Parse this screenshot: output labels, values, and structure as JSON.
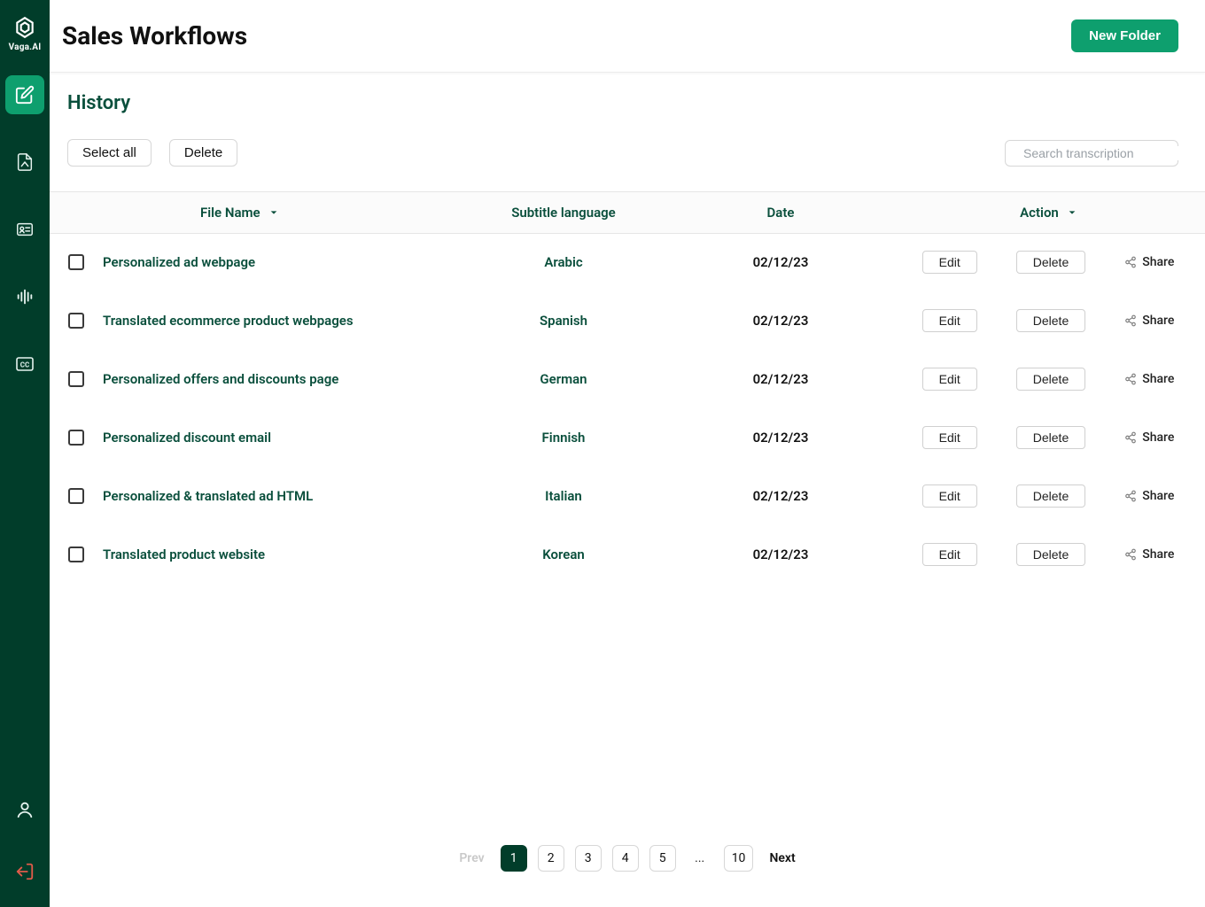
{
  "brand": {
    "name": "Vaga.AI"
  },
  "page": {
    "title": "Sales Workflows",
    "section_title": "History"
  },
  "actions": {
    "new_folder": "New Folder",
    "select_all": "Select all",
    "delete": "Delete",
    "search_placeholder": "Search transcription",
    "edit": "Edit",
    "row_delete": "Delete",
    "share": "Share"
  },
  "table": {
    "headers": {
      "file": "File Name",
      "lang": "Subtitle language",
      "date": "Date",
      "action": "Action"
    },
    "rows": [
      {
        "file": "Personalized ad webpage",
        "lang": "Arabic",
        "date": "02/12/23"
      },
      {
        "file": "Translated ecommerce product webpages",
        "lang": "Spanish",
        "date": "02/12/23"
      },
      {
        "file": "Personalized offers and discounts page",
        "lang": "German",
        "date": "02/12/23"
      },
      {
        "file": "Personalized discount email",
        "lang": "Finnish",
        "date": "02/12/23"
      },
      {
        "file": "Personalized & translated ad HTML",
        "lang": "Italian",
        "date": "02/12/23"
      },
      {
        "file": "Translated product website",
        "lang": "Korean",
        "date": "02/12/23"
      }
    ]
  },
  "pagination": {
    "prev": "Prev",
    "next": "Next",
    "pages": [
      "1",
      "2",
      "3",
      "4",
      "5"
    ],
    "ellipsis": "...",
    "last": "10",
    "active": "1"
  }
}
